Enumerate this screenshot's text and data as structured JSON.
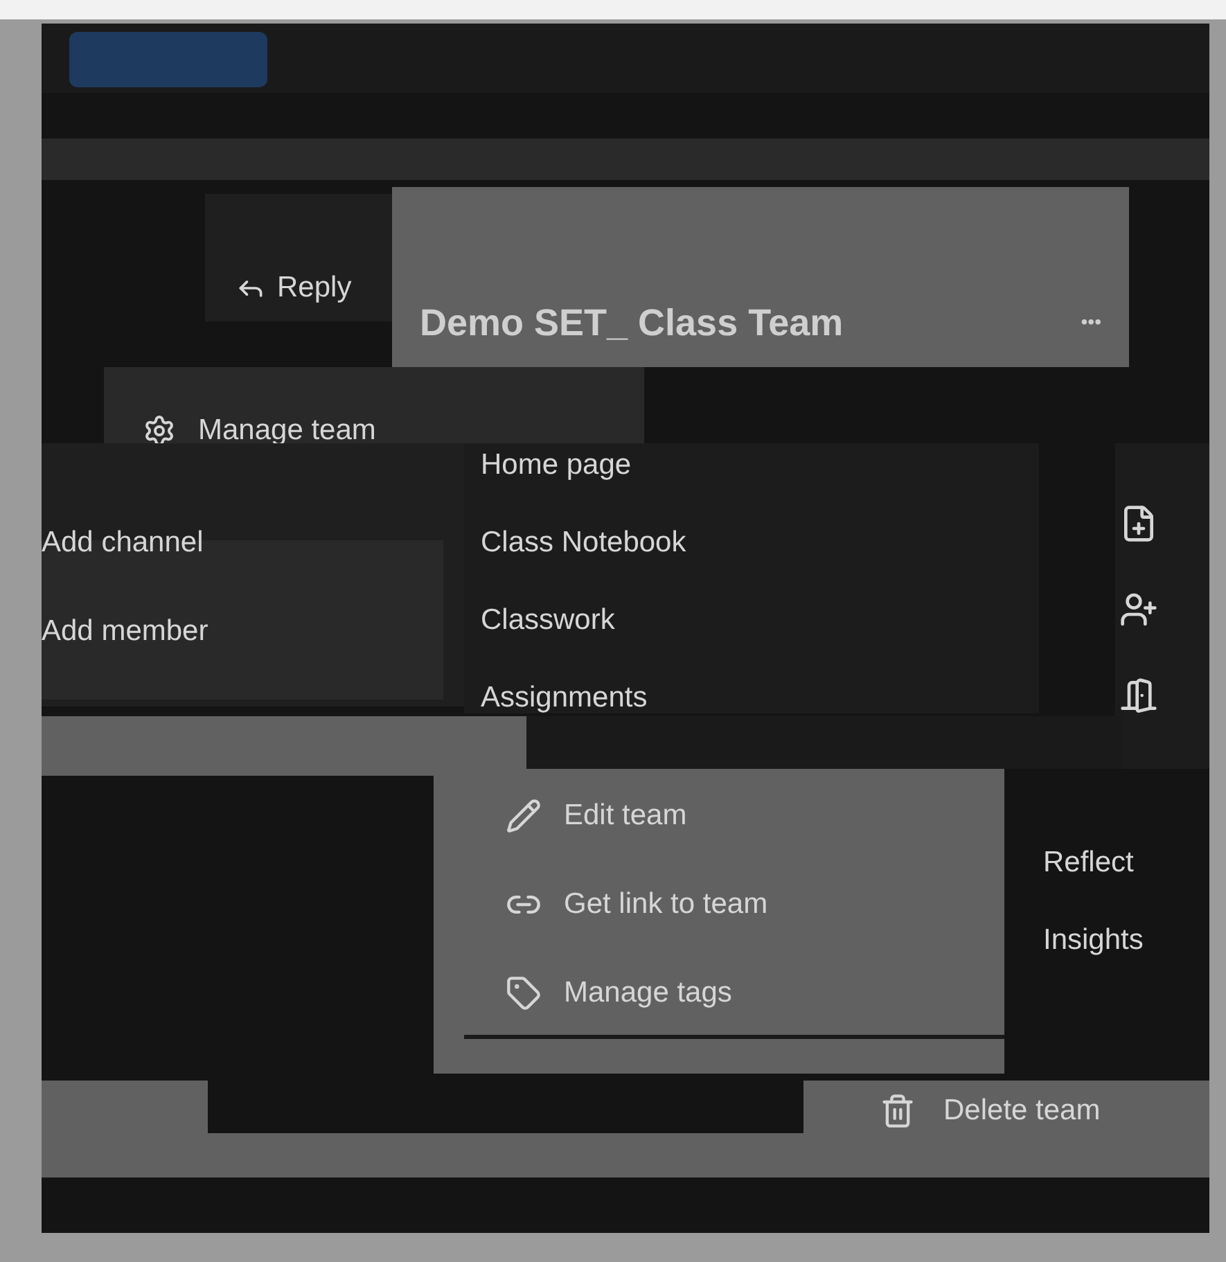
{
  "message": {
    "reply": "Reply"
  },
  "team_header": {
    "title": "Demo SET_ Class Team",
    "more": "•••"
  },
  "manage_menu": {
    "label": "Manage team"
  },
  "member_menu": [
    "Add channel",
    "Add member"
  ],
  "tabs_menu": [
    "Home page",
    "Class Notebook",
    "Classwork",
    "Assignments"
  ],
  "team_menu": [
    {
      "kind": "edit",
      "label": "Edit team"
    },
    {
      "kind": "link",
      "label": "Get link to team"
    },
    {
      "kind": "tags",
      "label": "Manage tags"
    }
  ],
  "side_menu": [
    "Reflect",
    "Insights"
  ],
  "delete": {
    "label": "Delete team"
  }
}
